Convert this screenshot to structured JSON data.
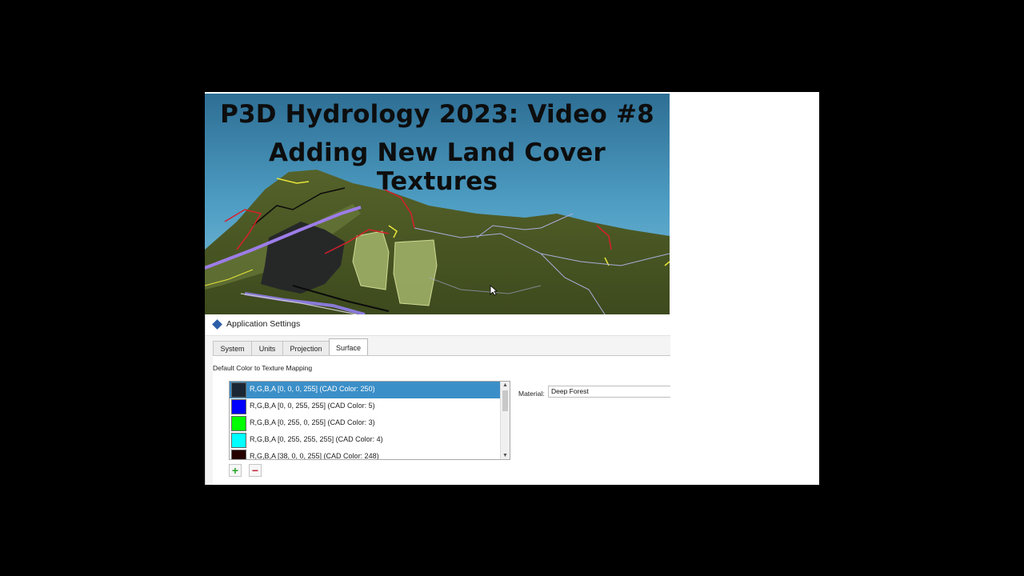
{
  "video_title": {
    "line1": "P3D Hydrology 2023:  Video #8",
    "line2": "Adding New Land Cover Textures"
  },
  "dialog": {
    "title": "Application Settings",
    "tabs": [
      {
        "label": "System",
        "active": false
      },
      {
        "label": "Units",
        "active": false
      },
      {
        "label": "Projection",
        "active": false
      },
      {
        "label": "Surface",
        "active": true
      }
    ],
    "section_label": "Default Color to Texture Mapping",
    "mappings": [
      {
        "text": "R,G,B,A [0, 0, 0, 255] (CAD Color: 250)",
        "color": "#1a2633",
        "selected": true
      },
      {
        "text": "R,G,B,A [0, 0, 255, 255] (CAD Color: 5)",
        "color": "#0000ff",
        "selected": false
      },
      {
        "text": "R,G,B,A [0, 255, 0, 255] (CAD Color: 3)",
        "color": "#00ff00",
        "selected": false
      },
      {
        "text": "R,G,B,A [0, 255, 255, 255] (CAD Color: 4)",
        "color": "#00ffff",
        "selected": false
      },
      {
        "text": "R,G,B,A [38, 0, 0, 255] (CAD Color: 248)",
        "color": "#260000",
        "selected": false
      }
    ],
    "material_label": "Material:",
    "material_value": "Deep Forest",
    "add_label": "+",
    "remove_label": "−"
  },
  "icons": {
    "app": "diamond-app-icon",
    "scroll_up": "chevron-up-icon",
    "scroll_down": "chevron-down-icon",
    "cursor": "mouse-pointer-icon"
  }
}
